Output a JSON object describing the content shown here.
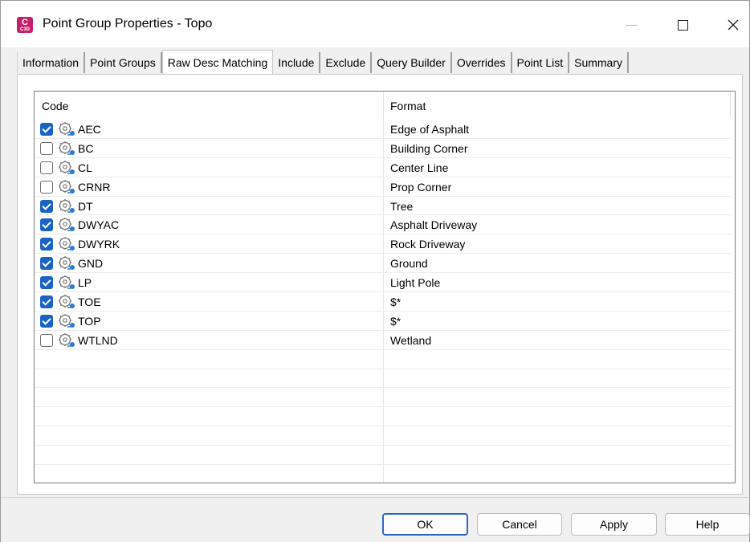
{
  "window": {
    "title": "Point Group Properties - Topo",
    "app_icon_letter": "C",
    "app_icon_sub": "C3D",
    "controls": {
      "minimize": "—",
      "maximize": "□",
      "close": "✕"
    }
  },
  "tabs": [
    {
      "label": "Information",
      "active": false
    },
    {
      "label": "Point Groups",
      "active": false
    },
    {
      "label": "Raw Desc Matching",
      "active": true
    },
    {
      "label": "Include",
      "active": false
    },
    {
      "label": "Exclude",
      "active": false
    },
    {
      "label": "Query Builder",
      "active": false
    },
    {
      "label": "Overrides",
      "active": false
    },
    {
      "label": "Point List",
      "active": false
    },
    {
      "label": "Summary",
      "active": false
    }
  ],
  "list": {
    "columns": {
      "code": "Code",
      "format": "Format"
    },
    "rows": [
      {
        "code": "AEC",
        "format": "Edge of Asphalt",
        "checked": true
      },
      {
        "code": "BC",
        "format": "Building Corner",
        "checked": false
      },
      {
        "code": "CL",
        "format": "Center Line",
        "checked": false
      },
      {
        "code": "CRNR",
        "format": "Prop Corner",
        "checked": false
      },
      {
        "code": "DT",
        "format": "Tree",
        "checked": true
      },
      {
        "code": "DWYAC",
        "format": "Asphalt Driveway",
        "checked": true
      },
      {
        "code": "DWYRK",
        "format": "Rock Driveway",
        "checked": true
      },
      {
        "code": "GND",
        "format": "Ground",
        "checked": true
      },
      {
        "code": "LP",
        "format": "Light Pole",
        "checked": true
      },
      {
        "code": "TOE",
        "format": "$*",
        "checked": true
      },
      {
        "code": "TOP",
        "format": "$*",
        "checked": true
      },
      {
        "code": "WTLND",
        "format": "Wetland",
        "checked": false
      }
    ],
    "row_icon": "description-key-icon"
  },
  "buttons": {
    "ok": "OK",
    "cancel": "Cancel",
    "apply": "Apply",
    "help": "Help"
  },
  "colors": {
    "accent": "#1a63c4",
    "app_icon": "#c81e6e",
    "default_button_border": "#2c67c8"
  }
}
